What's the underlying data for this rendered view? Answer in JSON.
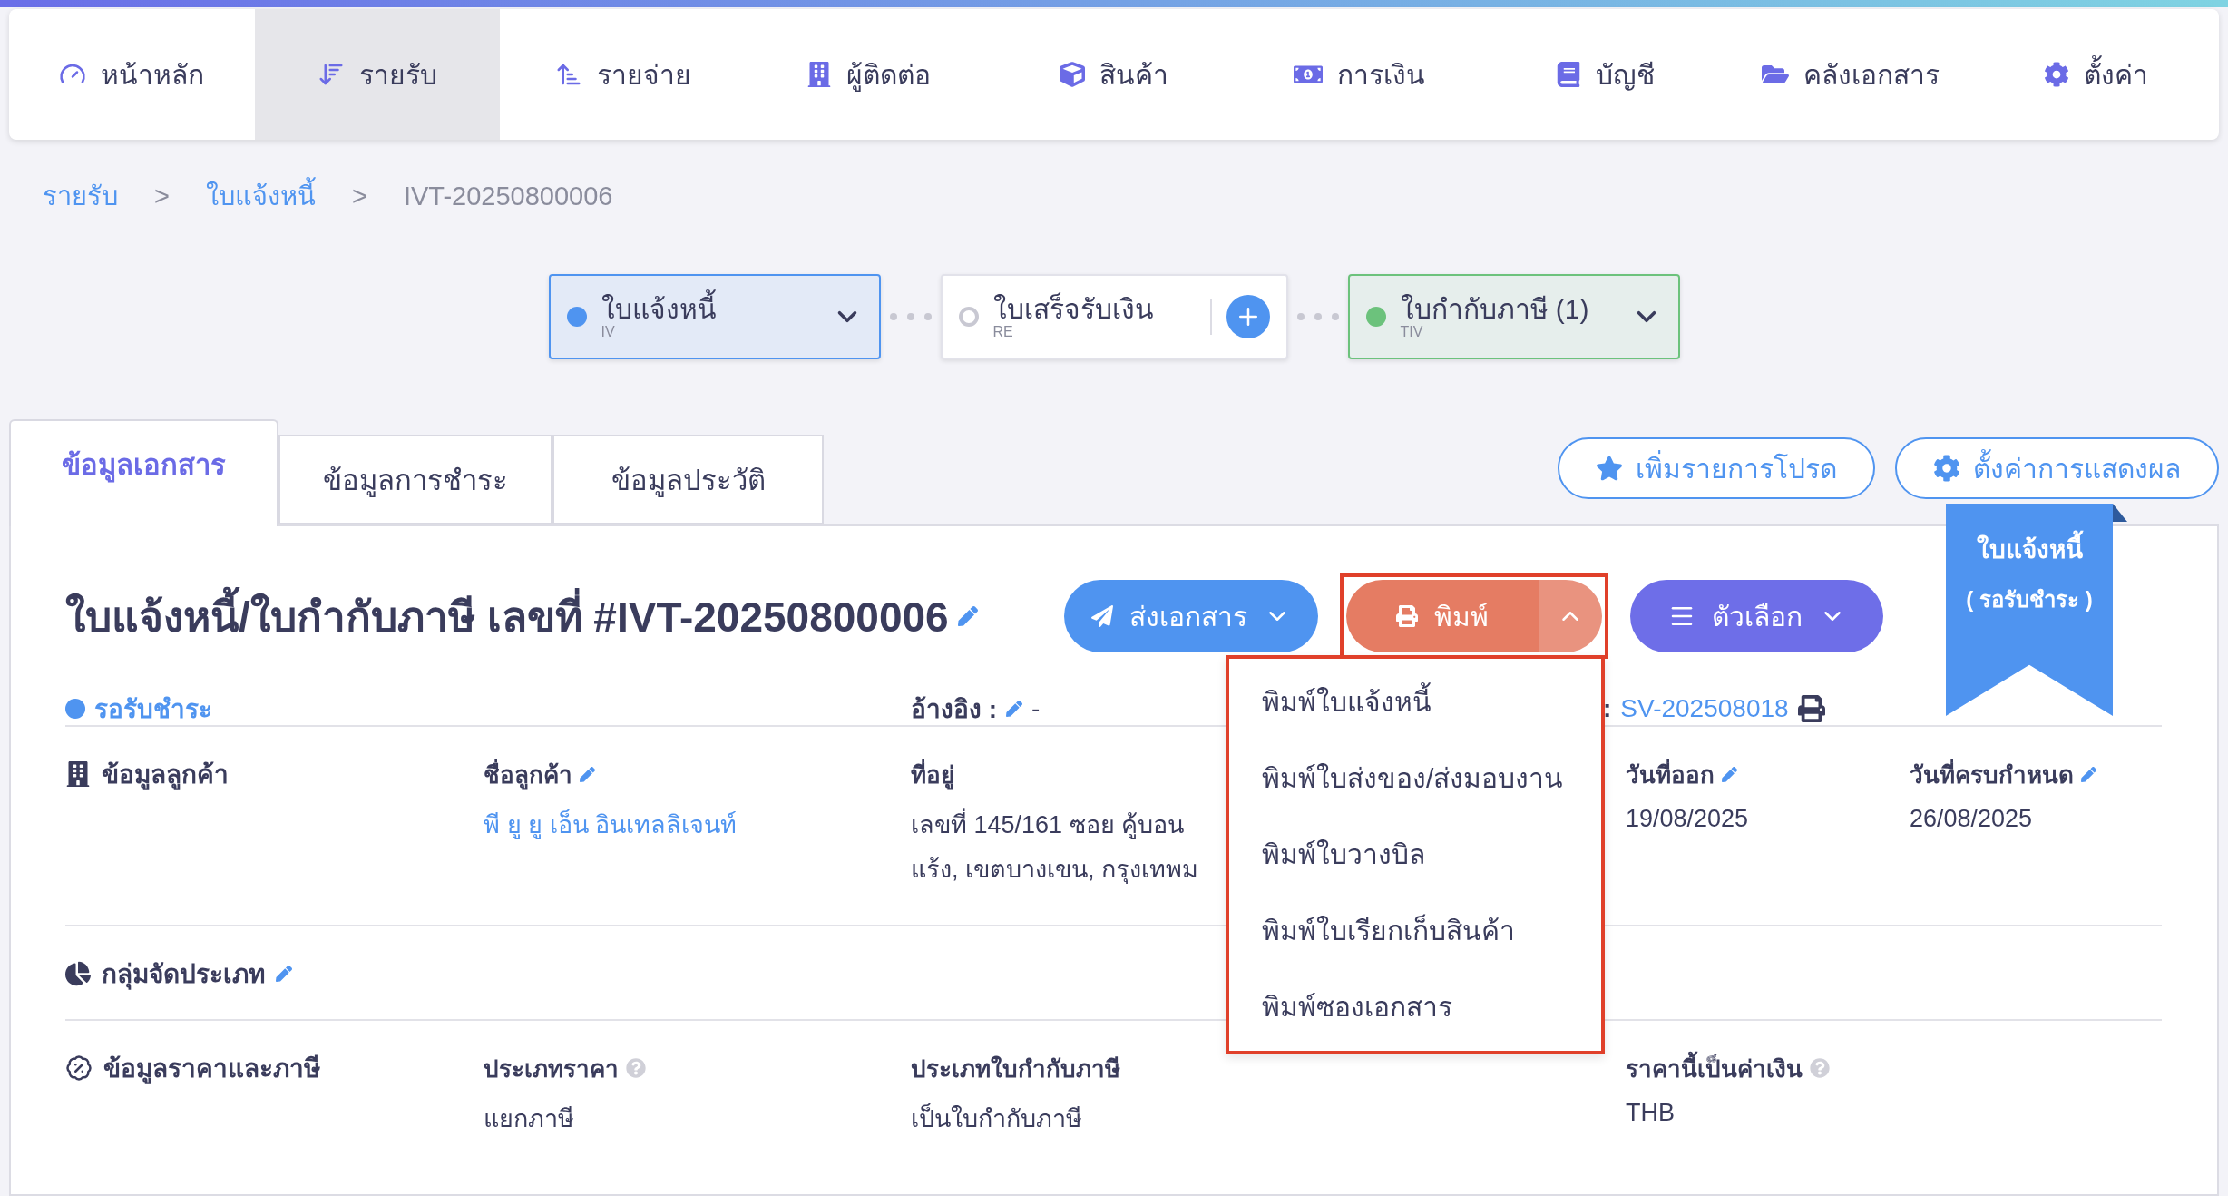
{
  "nav": [
    {
      "label": "หน้าหลัก",
      "selected": false
    },
    {
      "label": "รายรับ",
      "selected": true
    },
    {
      "label": "รายจ่าย",
      "selected": false
    },
    {
      "label": "ผู้ติดต่อ",
      "selected": false
    },
    {
      "label": "สินค้า",
      "selected": false
    },
    {
      "label": "การเงิน",
      "selected": false
    },
    {
      "label": "บัญชี",
      "selected": false
    },
    {
      "label": "คลังเอกสาร",
      "selected": false
    },
    {
      "label": "ตั้งค่า",
      "selected": false
    }
  ],
  "breadcrumb": [
    {
      "kind": "link",
      "label": "รายรับ"
    },
    {
      "kind": "separator",
      "label": ">"
    },
    {
      "kind": "link",
      "label": "ใบแจ้งหนี้"
    },
    {
      "kind": "separator",
      "label": ">"
    },
    {
      "kind": "current",
      "label": "IVT-20250800006"
    }
  ],
  "doc_chain": [
    {
      "title": "ใบแจ้งหนี้",
      "code": "IV",
      "color": "#4f94f0",
      "created": true
    },
    {
      "title": "ใบเสร็จรับเงิน",
      "code": "RE",
      "color": "#c8c8d2",
      "created": false
    },
    {
      "title": "ใบกำกับภาษี (1)",
      "code": "TIV",
      "color": "#6cc27c",
      "created": true
    }
  ],
  "tabs": [
    {
      "label": "ข้อมูลเอกสาร",
      "selected": true
    },
    {
      "label": "ข้อมูลการชำระ",
      "selected": false
    },
    {
      "label": "ข้อมูลประวัติ",
      "selected": false
    }
  ],
  "actions": [
    {
      "kind": "favorite",
      "label": "เพิ่มรายการโปรด"
    },
    {
      "kind": "settings",
      "label": "ตั้งค่าการแสดงผล"
    }
  ],
  "ribbon": {
    "title": "ใบแจ้งหนี้",
    "status": "( รอรับชำระ )"
  },
  "document": {
    "title": "ใบแจ้งหนี้/ใบกำกับภาษี เลขที่ #IVT-20250800006",
    "editable": true
  },
  "buttons": [
    {
      "kind": "send",
      "label": "ส่งเอกสาร",
      "expanded": false
    },
    {
      "kind": "print",
      "label": "พิมพ์",
      "expanded": true
    },
    {
      "kind": "options",
      "label": "ตัวเลือก",
      "expanded": false
    }
  ],
  "print_menu": [
    "พิมพ์ใบแจ้งหนี้",
    "พิมพ์ใบส่งของ/ส่งมอบงาน",
    "พิมพ์ใบวางบิล",
    "พิมพ์ใบเรียกเก็บสินค้า",
    "พิมพ์ซองเอกสาร"
  ],
  "status": {
    "label": "รอรับชำระ"
  },
  "reference": {
    "label": "อ้างอิง :",
    "value": "-",
    "editable": true
  },
  "sales_ref": {
    "label": ":",
    "value": "SV-202508018"
  },
  "sections": [
    {
      "kind": "customer",
      "title": "ข้อมูลลูกค้า",
      "editable": false,
      "fields": [
        {
          "label": "ชื่อลูกค้า",
          "editable": true,
          "help": false,
          "kind": "link",
          "lines": [
            "พี ยู ยู เอ็น อินเทลลิเจนท์"
          ]
        },
        {
          "label": "ที่อยู่",
          "editable": false,
          "help": false,
          "kind": "text",
          "lines": [
            "เลขที่ 145/161 ซอย คู้บอน",
            "แร้ง, เขตบางเขน, กรุงเทพม"
          ]
        },
        {
          "label": "วันที่ออก",
          "editable": true,
          "help": false,
          "kind": "text",
          "lines": [
            "19/08/2025"
          ]
        },
        {
          "label": "วันที่ครบกำหนด",
          "editable": true,
          "help": false,
          "kind": "text",
          "lines": [
            "26/08/2025"
          ]
        }
      ]
    },
    {
      "kind": "category",
      "title": "กลุ่มจัดประเภท",
      "editable": true
    },
    {
      "kind": "pricing",
      "title": "ข้อมูลราคาและภาษี",
      "editable": false,
      "fields": [
        {
          "label": "ประเภทราคา",
          "editable": false,
          "help": true,
          "kind": "text",
          "lines": [
            "แยกภาษี"
          ]
        },
        {
          "label": "ประเภทใบกำกับภาษี",
          "editable": false,
          "help": false,
          "kind": "text",
          "lines": [
            "เป็นใบกำกับภาษี"
          ]
        },
        {
          "label": "ราคานี้เป็นค่าเงิน",
          "editable": false,
          "help": true,
          "kind": "text",
          "lines": [
            "THB"
          ]
        }
      ]
    }
  ]
}
